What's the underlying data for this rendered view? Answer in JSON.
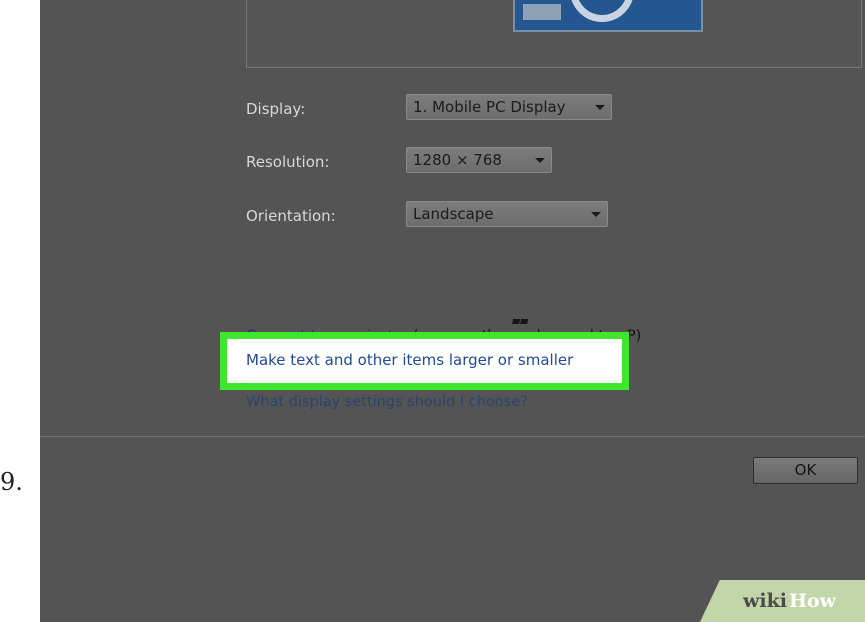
{
  "step_number": "9.",
  "settings": {
    "display_label": "Display:",
    "display_value": "1. Mobile PC Display",
    "resolution_label": "Resolution:",
    "resolution_value": "1280 × 768",
    "orientation_label": "Orientation:",
    "orientation_value": "Landscape"
  },
  "links": {
    "projector_link": "Connect to a projector",
    "projector_hint_before": " (or press the ",
    "projector_hint_after": " key and tap P)",
    "text_size_link": "Make text and other items larger or smaller",
    "display_settings_link": "What display settings should I choose?"
  },
  "buttons": {
    "ok": "OK"
  },
  "watermark": {
    "wiki": "wiki",
    "how": "How"
  },
  "colors": {
    "highlight": "#3ee62e",
    "link": "#1f4b97",
    "dimmed_background": "#545454"
  },
  "icons": {
    "windows_key": "windows-logo-icon",
    "dropdown": "chevron-down-icon"
  }
}
